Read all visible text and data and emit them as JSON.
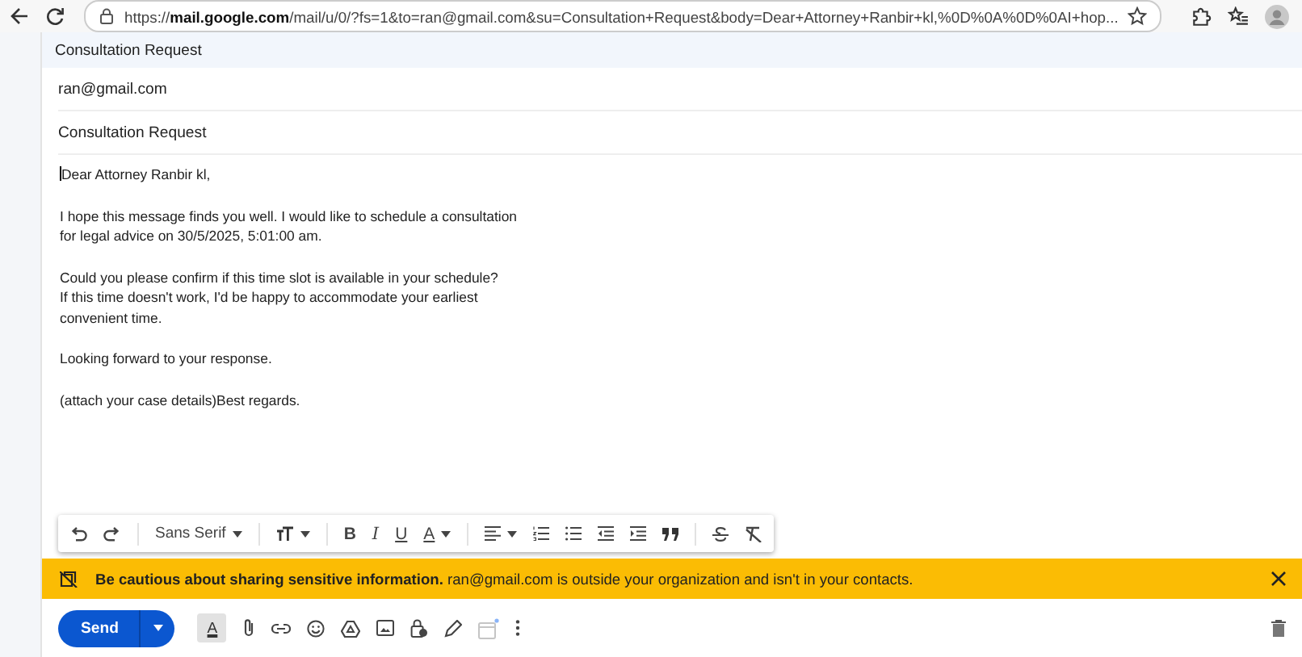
{
  "browser": {
    "url": "https://**mail.google.com**/mail/u/0/?fs=1&to=ran@gmail.com&su=Consultation+Request&body=Dear+Attorney+Ranbir+kl,%0D%0A%0D%0AI+hop..."
  },
  "compose": {
    "title": "Consultation Request",
    "to": "ran@gmail.com",
    "subject": "Consultation Request",
    "body": [
      {
        "lines": [
          "Dear Attorney Ranbir kl,"
        ],
        "cursor": true
      },
      {
        "lines": [
          "I hope this message finds you well. I would like to schedule a consultation",
          "for legal advice on 30/5/2025, 5:01:00 am."
        ],
        "cursor": false
      },
      {
        "lines": [
          "Could you please confirm if this time slot is available in your schedule?",
          "If this time doesn't work, I'd be happy to accommodate your earliest",
          "convenient time."
        ],
        "cursor": false
      },
      {
        "lines": [
          "Looking forward to your response."
        ],
        "cursor": false
      },
      {
        "lines": [
          "(attach your case details)Best regards."
        ],
        "cursor": false
      }
    ]
  },
  "format_toolbar": {
    "font": "Sans Serif",
    "bold": "B",
    "italic": "I",
    "underline": "U",
    "text_color": "A"
  },
  "warning": {
    "text": "**Be cautious about sharing sensitive information.** ran@gmail.com is outside your organization and isn't in your contacts."
  },
  "bottom_bar": {
    "send": "Send",
    "formatting_on": true,
    "text_color": "A"
  }
}
